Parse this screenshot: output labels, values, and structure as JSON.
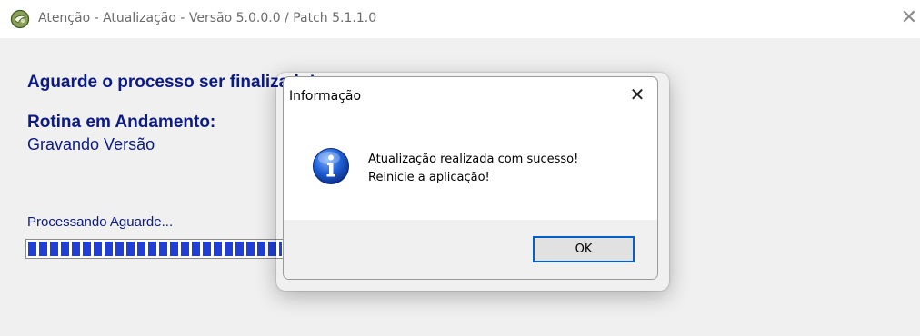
{
  "window": {
    "title": "Atenção - Atualização - Versão 5.0.0.0 / Patch 5.1.1.0",
    "close_icon": "close-icon"
  },
  "main": {
    "heading": "Aguarde o processo ser finalizado!",
    "routine_label": "Rotina em Andamento:",
    "routine_value": "Gravando Versão",
    "processing_label": "Processando Aguarde...",
    "progress_percent": 95,
    "accent_color": "#0c1a86",
    "progress_color": "#1f3fd6"
  },
  "dialog": {
    "title": "Informação",
    "icon": "info-icon",
    "message_line1": "Atualização realizada com sucesso!",
    "message_line2": "Reinicie a aplicação!",
    "ok_label": "OK"
  }
}
